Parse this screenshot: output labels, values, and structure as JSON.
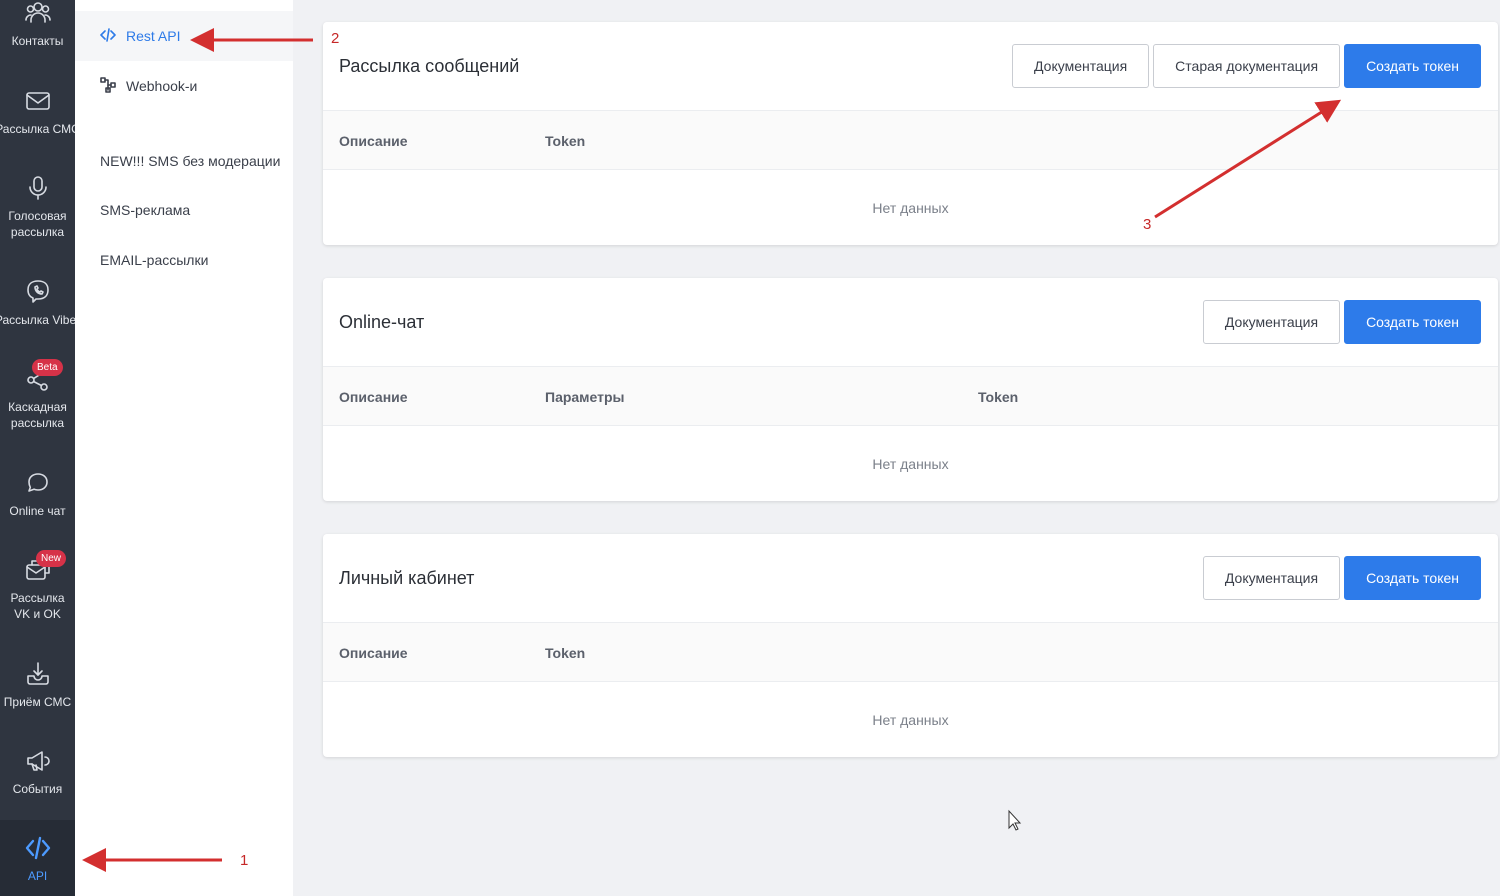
{
  "rail": {
    "items": [
      {
        "label": "Контакты",
        "icon": "contacts-icon"
      },
      {
        "label": "Рассылка СМС",
        "icon": "mail-icon"
      },
      {
        "label": "Голосовая рассылка",
        "icon": "microphone-icon"
      },
      {
        "label": "Рассылка Viber",
        "icon": "viber-icon"
      },
      {
        "label": "Каскадная рассылка",
        "icon": "share-icon",
        "badge": "Beta"
      },
      {
        "label": "Online чат",
        "icon": "chat-icon"
      },
      {
        "label": "Рассылка VK и OK",
        "icon": "social-mail-icon",
        "badge": "New"
      },
      {
        "label": "Приём СМС",
        "icon": "inbox-download-icon"
      },
      {
        "label": "События",
        "icon": "megaphone-icon"
      },
      {
        "label": "API",
        "icon": "code-icon",
        "active": true
      }
    ]
  },
  "submenu": {
    "items": [
      {
        "label": "Rest API",
        "icon": "code-icon",
        "active": true
      },
      {
        "label": "Webhook-и",
        "icon": "webhook-icon"
      },
      {
        "label": "NEW!!! SMS без модерации"
      },
      {
        "label": "SMS-реклама"
      },
      {
        "label": "EMAIL-рассылки"
      }
    ]
  },
  "cards": [
    {
      "title": "Рассылка сообщений",
      "buttons": [
        "Документация",
        "Старая документация",
        "Создать токен"
      ],
      "columns": [
        "Описание",
        "Token"
      ],
      "empty": "Нет данных"
    },
    {
      "title": "Online-чат",
      "buttons": [
        "Документация",
        "Создать токен"
      ],
      "columns": [
        "Описание",
        "Параметры",
        "Token"
      ],
      "empty": "Нет данных"
    },
    {
      "title": "Личный кабинет",
      "buttons": [
        "Документация",
        "Создать токен"
      ],
      "columns": [
        "Описание",
        "Token"
      ],
      "empty": "Нет данных"
    }
  ],
  "annotations": {
    "one": "1",
    "two": "2",
    "three": "3"
  },
  "colors": {
    "accent": "#2d7bea",
    "rail_bg": "#2f3540",
    "annotation": "#d32f2f",
    "badge": "#d63248"
  }
}
